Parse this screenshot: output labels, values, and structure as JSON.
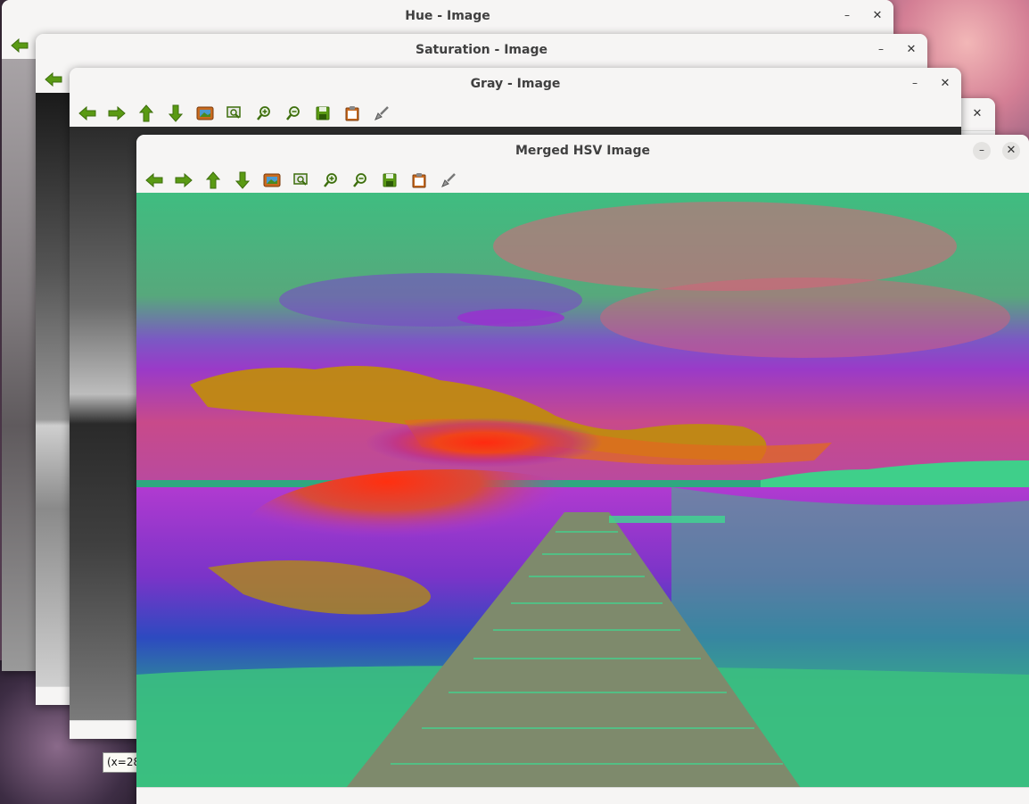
{
  "windows": {
    "hue": {
      "title": "Hue - Image"
    },
    "saturation": {
      "title": "Saturation - Image"
    },
    "gray": {
      "title": "Gray - Image"
    },
    "hidden": {
      "title": ""
    },
    "merged": {
      "title": "Merged HSV Image"
    }
  },
  "controls": {
    "minimize": "–",
    "close": "✕"
  },
  "toolbar_icons": [
    "arrow-left-icon",
    "arrow-right-icon",
    "arrow-up-icon",
    "arrow-down-icon",
    "image-icon",
    "zoom-fit-icon",
    "zoom-in-icon",
    "zoom-out-icon",
    "save-icon",
    "clipboard-icon",
    "brush-icon"
  ],
  "tooltip": {
    "text": "(x=28"
  },
  "colors": {
    "icon_green": "#5a9a14",
    "accent_orange": "#c86a1e"
  }
}
